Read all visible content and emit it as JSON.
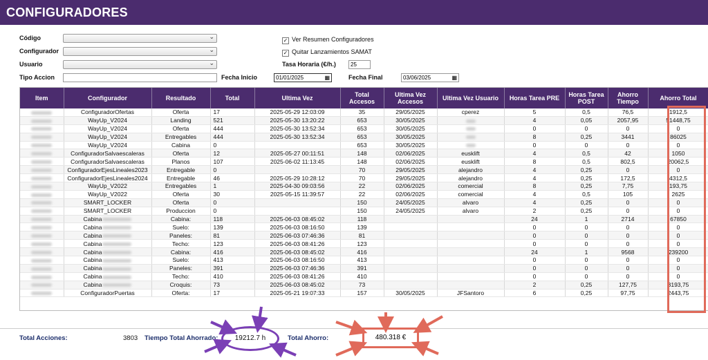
{
  "header": {
    "title": "CONFIGURADORES"
  },
  "filters": {
    "codigo_label": "Código",
    "configurador_label": "Configurador",
    "usuario_label": "Usuario",
    "tipo_accion_label": "Tipo Accion",
    "fecha_inicio_label": "Fecha Inicio",
    "fecha_inicio_value": "01/01/2025",
    "fecha_final_label": "Fecha Final",
    "fecha_final_value": "03/06/2025",
    "ver_resumen_label": "Ver Resumen Configuradores",
    "quitar_lanzamientos_label": "Quitar Lanzamientos SAMAT",
    "tasa_horaria_label": "Tasa Horaria (€/h.)",
    "tasa_horaria_value": "25"
  },
  "table": {
    "columns": [
      "Item",
      "Configurador",
      "Resultado",
      "Total",
      "Ultima Vez",
      "Total Accesos",
      "Ultima Vez Accesos",
      "Ultima Vez Usuario",
      "Horas Tarea PRE",
      "Horas Tarea POST",
      "Ahorro Tiempo",
      "Ahorro Total"
    ],
    "rows": [
      [
        "",
        "ConfiguradorOfertas",
        "Oferta",
        "17",
        "2025-05-29 12:03:09",
        "35",
        "29/05/2025",
        "cperez",
        "5",
        "0,5",
        "76,5",
        "1912,5"
      ],
      [
        "",
        "WayUp_V2024",
        "Landing",
        "521",
        "2025-05-30 13:20:22",
        "653",
        "30/05/2025",
        "",
        "4",
        "0,05",
        "2057,95",
        "51448,75"
      ],
      [
        "",
        "WayUp_V2024",
        "Oferta",
        "444",
        "2025-05-30 13:52:34",
        "653",
        "30/05/2025",
        "",
        "0",
        "0",
        "0",
        "0"
      ],
      [
        "",
        "WayUp_V2024",
        "Entregables",
        "444",
        "2025-05-30 13:52:34",
        "653",
        "30/05/2025",
        "",
        "8",
        "0,25",
        "3441",
        "86025"
      ],
      [
        "",
        "WayUp_V2024",
        "Cabina",
        "0",
        "",
        "653",
        "30/05/2025",
        "",
        "0",
        "0",
        "0",
        "0"
      ],
      [
        "",
        "ConfiguradorSalvaescaleras",
        "Oferta",
        "12",
        "2025-05-27 00:11:51",
        "148",
        "02/06/2025",
        "eusklift",
        "4",
        "0,5",
        "42",
        "1050"
      ],
      [
        "",
        "ConfiguradorSalvaescaleras",
        "Planos",
        "107",
        "2025-06-02 11:13:45",
        "148",
        "02/06/2025",
        "eusklift",
        "8",
        "0,5",
        "802,5",
        "20062,5"
      ],
      [
        "",
        "ConfiguradorEjesLineales2023",
        "Entregable",
        "0",
        "",
        "70",
        "29/05/2025",
        "alejandro",
        "4",
        "0,25",
        "0",
        "0"
      ],
      [
        "",
        "ConfiguradorEjesLineales2024",
        "Entregable",
        "46",
        "2025-05-29 10:28:12",
        "70",
        "29/05/2025",
        "alejandro",
        "4",
        "0,25",
        "172,5",
        "4312,5"
      ],
      [
        "",
        "WayUp_V2022",
        "Entregables",
        "1",
        "2025-04-30 09:03:56",
        "22",
        "02/06/2025",
        "comercial",
        "8",
        "0,25",
        "7,75",
        "193,75"
      ],
      [
        "",
        "WayUp_V2022",
        "Oferta",
        "30",
        "2025-05-15 11:39:57",
        "22",
        "02/06/2025",
        "comercial",
        "4",
        "0,5",
        "105",
        "2625"
      ],
      [
        "",
        "SMART_LOCKER",
        "Oferta",
        "0",
        "",
        "150",
        "24/05/2025",
        "alvaro",
        "4",
        "0,25",
        "0",
        "0"
      ],
      [
        "",
        "SMART_LOCKER",
        "Produccion",
        "0",
        "",
        "150",
        "24/05/2025",
        "alvaro",
        "2",
        "0,25",
        "0",
        "0"
      ],
      [
        "",
        "Cabina",
        "Cabina:",
        "118",
        "2025-06-03 08:45:02",
        "118",
        "",
        "",
        "24",
        "1",
        "2714",
        "67850"
      ],
      [
        "",
        "Cabina",
        "Suelo:",
        "139",
        "2025-06-03 08:16:50",
        "139",
        "",
        "",
        "0",
        "0",
        "0",
        "0"
      ],
      [
        "",
        "Cabina",
        "Paneles:",
        "81",
        "2025-06-03 07:46:36",
        "81",
        "",
        "",
        "0",
        "0",
        "0",
        "0"
      ],
      [
        "",
        "Cabina",
        "Techo:",
        "123",
        "2025-06-03 08:41:26",
        "123",
        "",
        "",
        "0",
        "0",
        "0",
        "0"
      ],
      [
        "",
        "Cabina",
        "Cabina:",
        "416",
        "2025-06-03 08:45:02",
        "416",
        "",
        "",
        "24",
        "1",
        "9568",
        "239200"
      ],
      [
        "",
        "Cabina",
        "Suelo:",
        "413",
        "2025-06-03 08:16:50",
        "413",
        "",
        "",
        "0",
        "0",
        "0",
        "0"
      ],
      [
        "",
        "Cabina",
        "Paneles:",
        "391",
        "2025-06-03 07:46:36",
        "391",
        "",
        "",
        "0",
        "0",
        "0",
        "0"
      ],
      [
        "",
        "Cabina",
        "Techo:",
        "410",
        "2025-06-03 08:41:26",
        "410",
        "",
        "",
        "0",
        "0",
        "0",
        "0"
      ],
      [
        "",
        "Cabina",
        "Croquis:",
        "73",
        "2025-06-03 08:45:02",
        "73",
        "",
        "",
        "2",
        "0,25",
        "127,75",
        "3193,75"
      ],
      [
        "",
        "ConfiguradorPuertas",
        "Oferta:",
        "17",
        "2025-05-21 19:07:33",
        "157",
        "30/05/2025",
        "JFSantoro",
        "6",
        "0,25",
        "97,75",
        "2443,75"
      ]
    ]
  },
  "summary": {
    "total_acciones_label": "Total Acciones:",
    "total_acciones_value": "3803",
    "tiempo_total_label": "Tiempo Total Ahorrado:",
    "tiempo_total_value": "19212.7 h",
    "total_ahorro_label": "Total Ahorro:",
    "total_ahorro_value": "480.318 €"
  },
  "colors": {
    "header_bg": "#4b2c6e",
    "table_header_bg": "#4b2c6e",
    "highlight_red": "#e06a5a",
    "highlight_purple": "#7a3fb5"
  }
}
